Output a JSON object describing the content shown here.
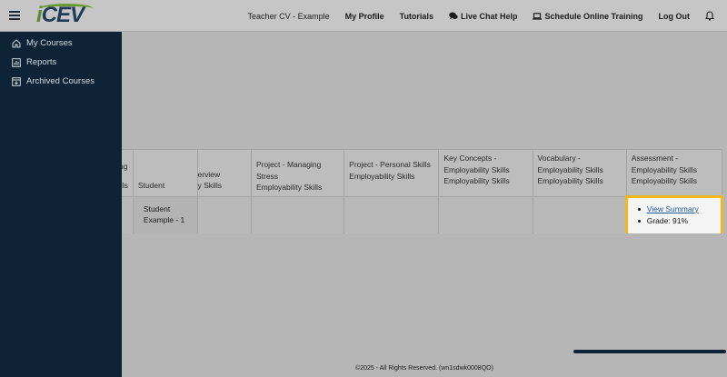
{
  "header": {
    "logo_text": "iCEV",
    "user_name": "Teacher CV - Example",
    "links": {
      "my_profile": "My Profile",
      "tutorials": "Tutorials",
      "live_chat": "Live Chat Help",
      "schedule": "Schedule Online Training",
      "logout": "Log Out"
    }
  },
  "sidebar": {
    "items": [
      {
        "label": "My Courses",
        "icon": "home-icon"
      },
      {
        "label": "Reports",
        "icon": "chart-icon"
      },
      {
        "label": "Archived Courses",
        "icon": "archive-icon"
      }
    ]
  },
  "table": {
    "headers": [
      [
        "ng",
        "ills"
      ],
      [
        "",
        "Student"
      ],
      [
        "erview",
        "y Skills"
      ],
      [
        "Project - Managing Stress",
        "Employability Skills"
      ],
      [
        "Project - Personal Skills",
        "Employability Skills"
      ],
      [
        "Key Concepts -",
        "Employability Skills",
        "Employability Skills"
      ],
      [
        "Vocabulary -",
        "Employability Skills",
        "Employability Skills"
      ],
      [
        "Assessment -",
        "Employability Skills",
        "Employability Skills"
      ]
    ],
    "row": {
      "student": "Student Example - 1",
      "view_summary": "View Summary",
      "grade": "Grade: 91%"
    }
  },
  "footer": {
    "text": "©2025 - All Rights Reserved.",
    "code": "(wn1sdwk0008QO)"
  },
  "colors": {
    "sidebar_bg": "#0e2436",
    "highlight_border": "#f2b81c",
    "link": "#1a5a96"
  }
}
